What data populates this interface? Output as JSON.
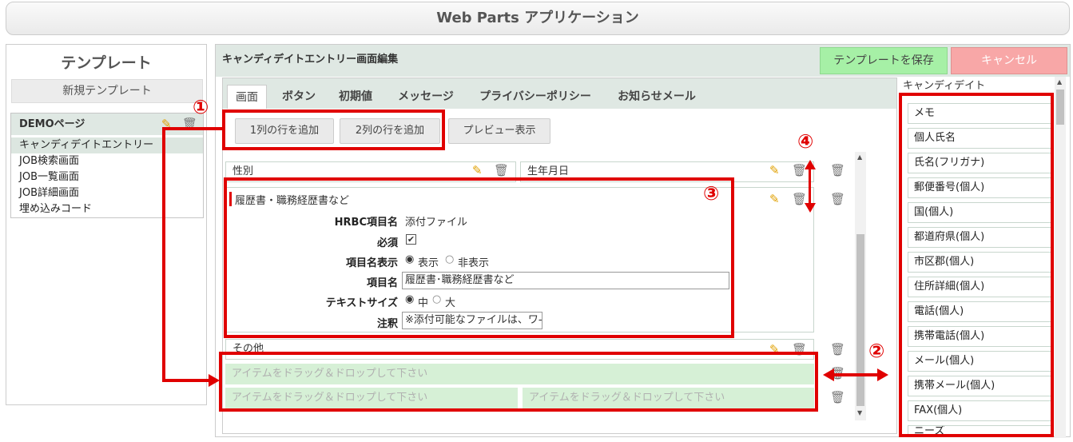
{
  "app_title": "Web Parts アプリケーション",
  "left": {
    "title": "テンプレート",
    "new_template": "新規テンプレート",
    "page_name": "DEMOページ",
    "pages": [
      "キャンディデイトエントリー",
      "JOB検索画面",
      "JOB一覧画面",
      "JOB詳細画面",
      "埋め込みコード"
    ]
  },
  "editor": {
    "title": "キャンディデイトエントリー画面編集",
    "save": "テンプレートを保存",
    "cancel": "キャンセル",
    "tabs": [
      "画面",
      "ボタン",
      "初期値",
      "メッセージ",
      "プライバシーポリシー",
      "お知らせメール"
    ],
    "actions": {
      "add1": "1列の行を追加",
      "add2": "2列の行を追加",
      "preview": "プレビュー表示"
    },
    "rows": {
      "gender": "性別",
      "birth": "生年月日",
      "resume": "履歴書・職務経歴書など",
      "other": "その他"
    },
    "detail": {
      "hrbc_label": "HRBC項目名",
      "hrbc_value": "添付ファイル",
      "required_label": "必須",
      "required_checked": true,
      "display_label": "項目名表示",
      "display_show": "表示",
      "display_hide": "非表示",
      "name_label": "項目名",
      "name_value": "履歴書･職務経歴書など",
      "size_label": "テキストサイズ",
      "size_mid": "中",
      "size_large": "大",
      "note_label": "注釈",
      "note_value": "※添付可能なファイルは、ワ-"
    },
    "drop_text": "アイテムをドラッグ＆ドロップして下さい"
  },
  "candidate": {
    "title": "キャンディデイト",
    "items": [
      "メモ",
      "個人氏名",
      "氏名(フリガナ)",
      "郵便番号(個人)",
      "国(個人)",
      "都道府県(個人)",
      "市区郡(個人)",
      "住所詳細(個人)",
      "電話(個人)",
      "携帯電話(個人)",
      "メール(個人)",
      "携帯メール(個人)",
      "FAX(個人)",
      "ニーズ"
    ]
  },
  "annotations": [
    "①",
    "②",
    "③",
    "④"
  ],
  "colors": {
    "red": "#e00000",
    "green": "#a6f0a6",
    "pink": "#f8a7a7",
    "header": "#dfe8e3",
    "drop": "#d6f0d6"
  }
}
